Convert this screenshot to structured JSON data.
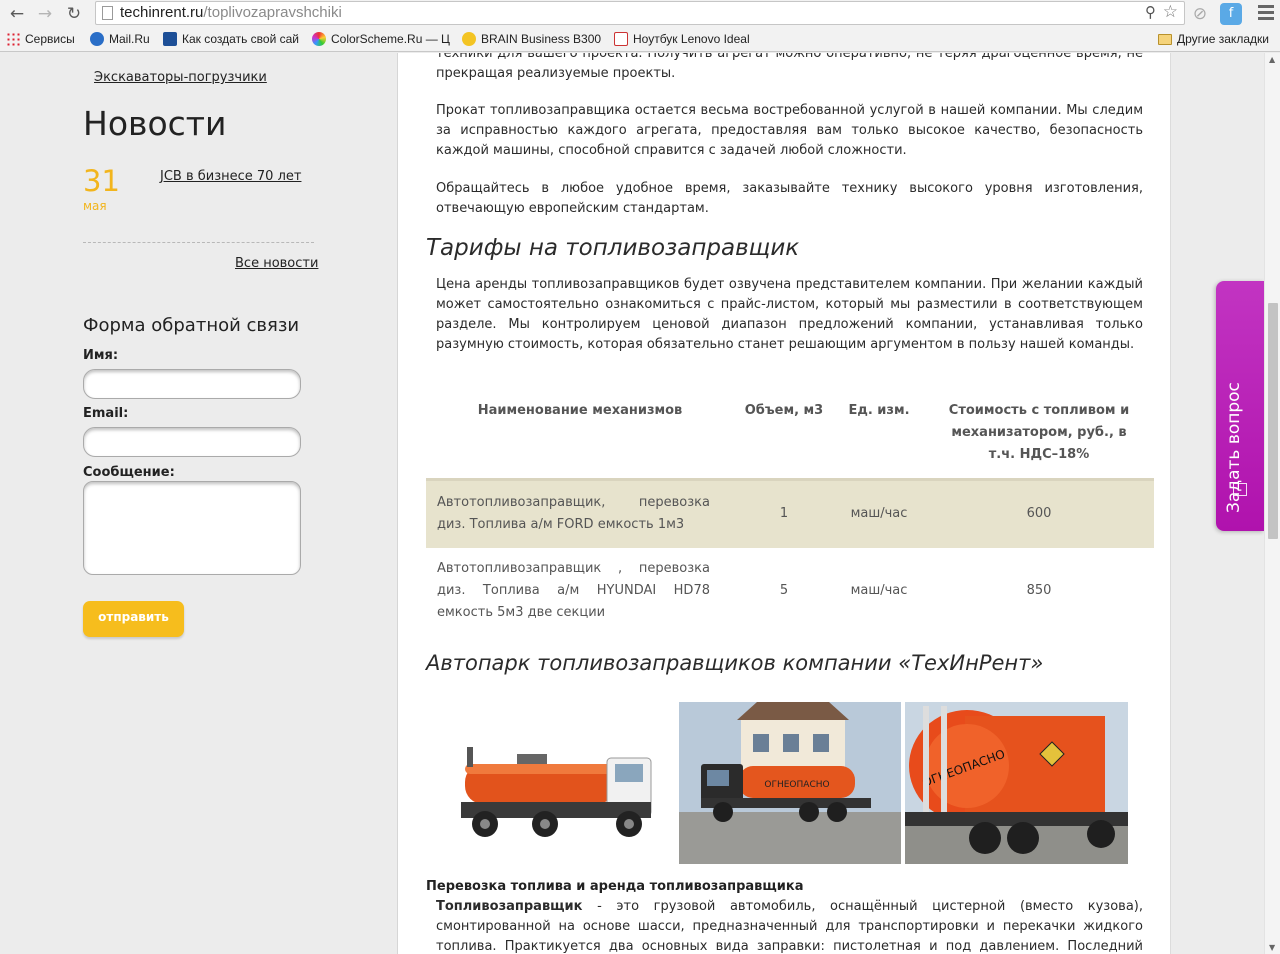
{
  "browser": {
    "url_domain": "techinrent.ru",
    "url_path": "/toplivozapravshchiki",
    "bookmarks": [
      {
        "label": "Сервисы",
        "icon": "apps-icon"
      },
      {
        "label": "Mail.Ru",
        "icon": "mailru-icon"
      },
      {
        "label": "Как создать свой сай",
        "icon": "site-icon"
      },
      {
        "label": "ColorScheme.Ru — Ц",
        "icon": "colorscheme-icon"
      },
      {
        "label": "BRAIN Business B300",
        "icon": "brain-icon"
      },
      {
        "label": "Ноутбук Lenovo Ideal",
        "icon": "page-icon"
      }
    ],
    "other_bookmarks": "Другие закладки"
  },
  "sidebar": {
    "top_link": "Экскаваторы-погрузчики",
    "news_heading": "Новости",
    "news_item": {
      "day": "31",
      "month": "мая",
      "title": "JCB в бизнесе 70 лет"
    },
    "all_news": "Все новости",
    "form": {
      "title": "Форма обратной связи",
      "name_label": "Имя:",
      "name_value": "",
      "email_label": "Email:",
      "email_value": "",
      "message_label": "Сообщение:",
      "message_value": "",
      "submit": "отправить"
    }
  },
  "content": {
    "p0": "техники для вашего проекта. Получить агрегат можно оперативно, не теряя драгоценное время, не прекращая реализуемые проекты.",
    "p1": "Прокат топливозаправщика остается весьма востребованной услугой в нашей компании. Мы следим за исправностью каждого агрегата, предоставляя вам только высокое качество, безопасность каждой машины, способной справится с задачей любой сложности.",
    "p2": "Обращайтесь в любое удобное время, заказывайте технику высокого уровня изготовления, отвечающую европейским стандартам.",
    "tariffs_heading": "Тарифы на топливозаправщик",
    "p3": "Цена аренды топливозаправщиков будет озвучена представителем компании. При желании каждый может самостоятельно ознакомиться с прайс-листом, который мы разместили в соответствующем разделе. Мы контролируем ценовой диапазон предложений компании, устанавливая только разумную стоимость, которая обязательно станет решающим аргументом в пользу нашей команды.",
    "table": {
      "headers": [
        "Наименование механизмов",
        "Объем, м3",
        "Ед. изм.",
        "Стоимость с топливом и механизатором, руб., в т.ч. НДС–18%"
      ],
      "rows": [
        {
          "name": "Автотопливозаправщик, перевозка диз. Топлива а/м FORD емкость 1м3",
          "volume": "1",
          "unit": "маш/час",
          "price": "600"
        },
        {
          "name": "Автотопливозаправщик , перевозка диз. Топлива а/м HYUNDAI HD78 емкость 5м3 две секции",
          "volume": "5",
          "unit": "маш/час",
          "price": "850"
        }
      ]
    },
    "fleet_heading": "Автопарк топливозаправщиков компании «ТехИнРент»",
    "photo_labels": [
      "ОГНЕОПАСНО",
      "ОГНЕОПАСНО"
    ],
    "transport_heading": "Перевозка топлива и аренда топливозаправщика",
    "p4_bold": "Топливозаправщик",
    "p4": " - это грузовой автомобиль, оснащённый цистерной (вместо кузова), смонтированной на основе шасси, предназначенный для транспортировки и перекачки жидкого топлива. Практикуется два основных вида заправки: пистолетная и под давлением. Последний является более эффективным для"
  },
  "ask_tab": {
    "label": "Задать вопрос"
  },
  "colors": {
    "accent": "#f6bd1d",
    "tab": "#b418b0",
    "table_row": "#e7e3cd"
  }
}
